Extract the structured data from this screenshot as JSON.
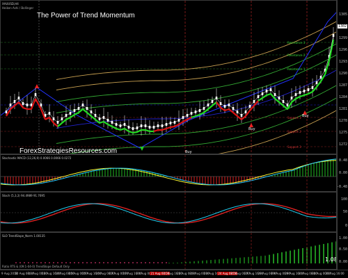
{
  "chart": {
    "symbol_label": "XAUUSD,H4",
    "indicator_label": "Heiken Ashi / Bollinger",
    "title": "The Power of Trend Momentum",
    "watermark": "ForexStrategiesResources.com",
    "price_scale": [
      "1305",
      "1302",
      "1299",
      "1296",
      "1293",
      "1290",
      "1287",
      "1284",
      "1281",
      "1278",
      "1275",
      "1272"
    ],
    "current_price": "1302",
    "bands": [
      {
        "label": "Resistance 3",
        "color": "#33cc33"
      },
      {
        "label": "Resistance 2",
        "color": "#33cc33"
      },
      {
        "label": "Resistance 1",
        "color": "#33cc33"
      },
      {
        "label": "Support 1",
        "color": "#cc3333"
      },
      {
        "label": "Support 2",
        "color": "#cc3333"
      },
      {
        "label": "Support 3",
        "color": "#cc3333"
      }
    ],
    "buy_labels": [
      "Buy",
      "Buy",
      "Buy"
    ]
  },
  "macd": {
    "label": "Stochastic MACD (12,26,9) 0.0066 0.0066 0.0272",
    "scale": [
      "0.48",
      "0.00",
      "-0.48"
    ]
  },
  "stoch": {
    "label": "Stoch (5,3,3) 94.4989 91.7695",
    "scale": [
      "100",
      "50",
      "0"
    ]
  },
  "slope": {
    "label": "SLO TrendSlope_Norm 1.00135",
    "scale": [
      "1.00",
      "0.50",
      "0.00"
    ],
    "current": "1.08",
    "footer": "Ratio RTS & (09:1-04-0) TrendSlope Default Only"
  },
  "xaxis": {
    "ticks": [
      {
        "t": "9 Aug 2018",
        "red": false
      },
      {
        "t": "10 Aug 08:00",
        "red": false
      },
      {
        "t": "13 Aug 00:00",
        "red": false
      },
      {
        "t": "13 Aug 16:00",
        "red": false
      },
      {
        "t": "14 Aug 08:00",
        "red": false
      },
      {
        "t": "15 Aug 00:00",
        "red": false
      },
      {
        "t": "15 Aug 16:00",
        "red": false
      },
      {
        "t": "16 Aug 08:00",
        "red": false
      },
      {
        "t": "17 Aug 00:00",
        "red": false
      },
      {
        "t": "17 Aug 16:00",
        "red": false
      },
      {
        "t": "20 Aug 08:00",
        "red": false
      },
      {
        "t": "21 Aug 00:00",
        "red": true
      },
      {
        "t": "21 Aug 16:00",
        "red": false
      },
      {
        "t": "22 Aug 08:00",
        "red": false
      },
      {
        "t": "23 Aug 00:00",
        "red": false
      },
      {
        "t": "23 Aug 16:00",
        "red": false
      },
      {
        "t": "24 Aug 08:00",
        "red": true
      },
      {
        "t": "27 Aug 00:00",
        "red": false
      },
      {
        "t": "27 Aug 16:00",
        "red": false
      },
      {
        "t": "28 Aug 08:00",
        "red": false
      },
      {
        "t": "29 Aug 00:00",
        "red": false
      },
      {
        "t": "29 Aug 16:00",
        "red": false
      },
      {
        "t": "30 Aug 08:00",
        "red": false
      },
      {
        "t": "31 Aug 00:00",
        "red": false
      },
      {
        "t": "31 Aug 16:00",
        "red": false
      }
    ]
  }
}
